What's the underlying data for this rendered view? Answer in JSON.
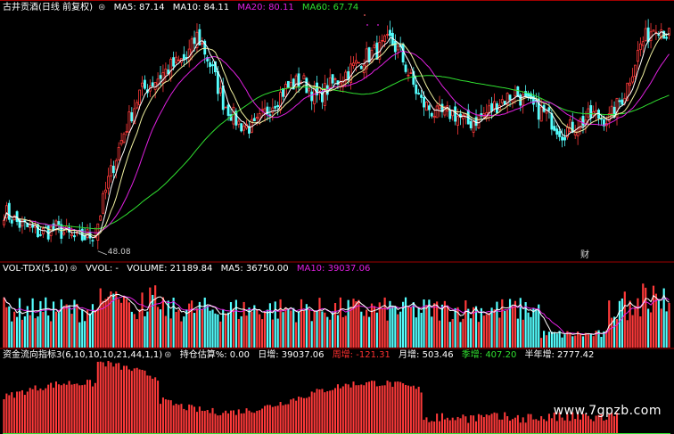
{
  "price_panel": {
    "stock_label": "古井贡酒(日线 前复权)",
    "legend": [
      {
        "label": "MA5: 87.14",
        "color": "#ffffff"
      },
      {
        "label": "MA10: 84.11",
        "color": "#ffffff"
      },
      {
        "label": "MA20: 80.11",
        "color": "#e020e0"
      },
      {
        "label": "MA60: 67.74",
        "color": "#30e030"
      }
    ],
    "low_marker": "48.08",
    "cai_marker": "财"
  },
  "volume_panel": {
    "title": "VOL-TDX(5,10)",
    "vvol": "VVOL: -",
    "legend": [
      {
        "label": "VOLUME: 21189.84",
        "color": "#ffffff"
      },
      {
        "label": "MA5: 36750.00",
        "color": "#ffffff"
      },
      {
        "label": "MA10: 39037.06",
        "color": "#e020e0"
      }
    ]
  },
  "flow_panel": {
    "title": "资金流向指标3(6,10,10,10,21,44,1,1)",
    "legend": [
      {
        "label": "持仓估算%: 0.00",
        "color": "#ffffff"
      },
      {
        "label": "日增: 39037.06",
        "color": "#ffffff"
      },
      {
        "label": "周增: -121.31",
        "color": "#ff3030"
      },
      {
        "label": "月增: 503.46",
        "color": "#ffffff"
      },
      {
        "label": "季增: 407.20",
        "color": "#30e030"
      },
      {
        "label": "半年增: 2777.42",
        "color": "#ffffff"
      }
    ]
  },
  "watermark": "www.7gpzb.com",
  "colors": {
    "up": "#ff3a3a",
    "down": "#54ffff",
    "ma5": "#ffffff",
    "ma10": "#f0f0a0",
    "ma20": "#e020e0",
    "ma60": "#30e030",
    "divider": "#a00000"
  },
  "chart_data": {
    "type": "candlestick",
    "price_anchors": [
      [
        0,
        55
      ],
      [
        6,
        52
      ],
      [
        14,
        50
      ],
      [
        20,
        51
      ],
      [
        28,
        48.5
      ],
      [
        35,
        50
      ],
      [
        40,
        62
      ],
      [
        46,
        73
      ],
      [
        52,
        82
      ],
      [
        58,
        85
      ],
      [
        64,
        88
      ],
      [
        70,
        90
      ],
      [
        74,
        95
      ],
      [
        76,
        93
      ],
      [
        80,
        87
      ],
      [
        84,
        80
      ],
      [
        90,
        75
      ],
      [
        96,
        74
      ],
      [
        102,
        79
      ],
      [
        108,
        83
      ],
      [
        114,
        85
      ],
      [
        120,
        81
      ],
      [
        126,
        84
      ],
      [
        132,
        87
      ],
      [
        138,
        90
      ],
      [
        144,
        92
      ],
      [
        148,
        94
      ],
      [
        152,
        91
      ],
      [
        156,
        85
      ],
      [
        160,
        80
      ],
      [
        166,
        77
      ],
      [
        172,
        77.5
      ],
      [
        178,
        75
      ],
      [
        184,
        77
      ],
      [
        190,
        80
      ],
      [
        196,
        82
      ],
      [
        202,
        79
      ],
      [
        208,
        77
      ],
      [
        214,
        73
      ],
      [
        220,
        75
      ],
      [
        226,
        77
      ],
      [
        232,
        76
      ],
      [
        238,
        82
      ],
      [
        244,
        93
      ],
      [
        250,
        98
      ],
      [
        255,
        95
      ]
    ],
    "candle_count": 256,
    "price_range": [
      44,
      100
    ],
    "volume_range": [
      0,
      100
    ],
    "flow_range": [
      0,
      100
    ]
  }
}
